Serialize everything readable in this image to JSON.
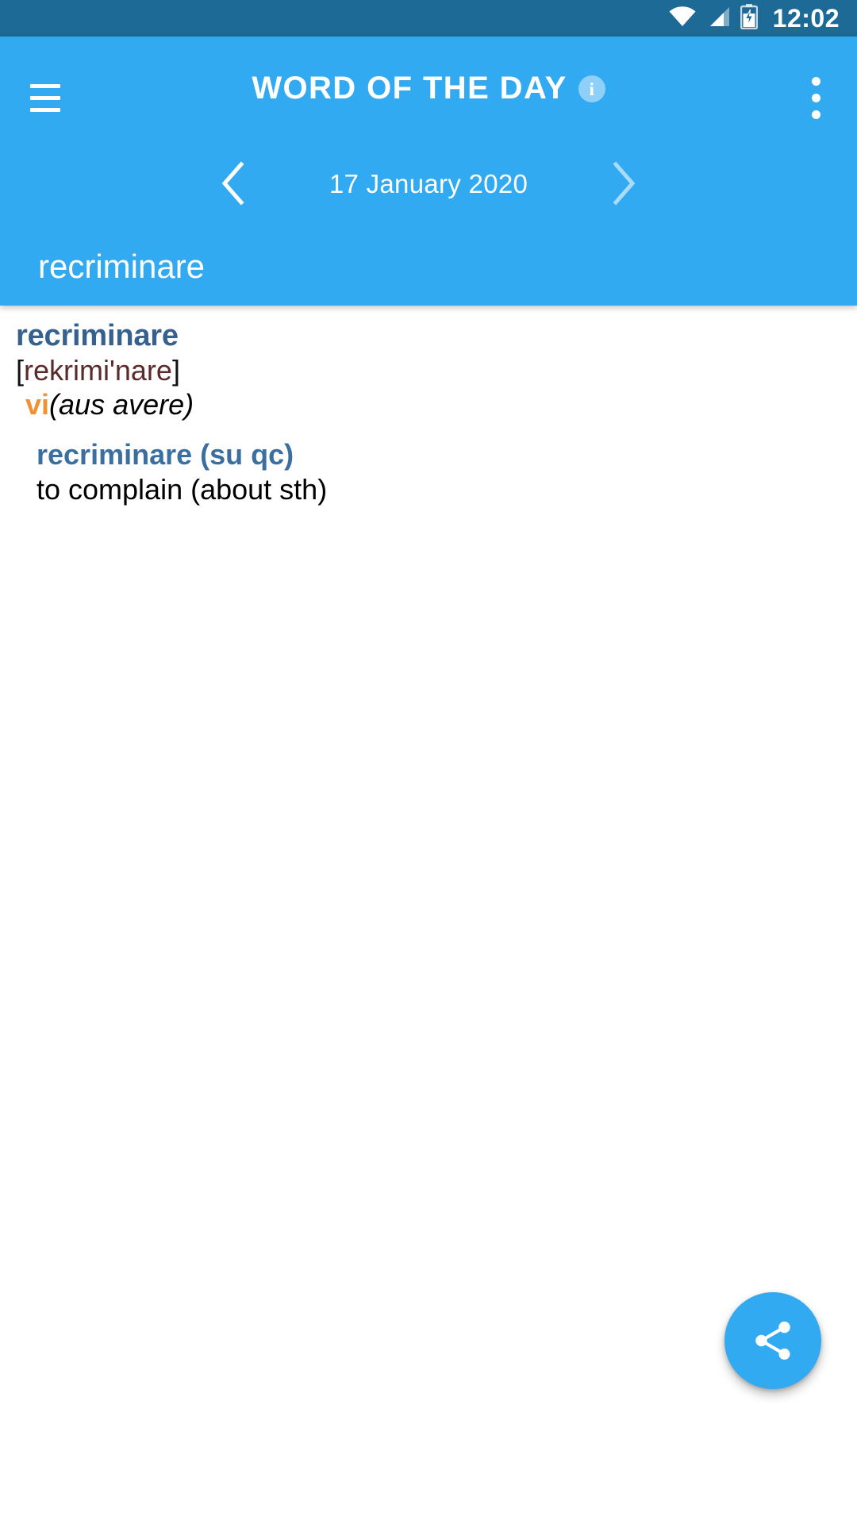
{
  "status_bar": {
    "time": "12:02",
    "wifi_icon": "wifi-icon",
    "signal_icon": "signal-bars-icon",
    "battery_icon": "battery-charging-icon",
    "background_color": "#1C6A95"
  },
  "header": {
    "background_color": "#32AAF2",
    "menu_icon": "hamburger-menu-icon",
    "title": "WORD OF THE DAY",
    "info_icon": "info-icon",
    "info_glyph": "i",
    "overflow_icon": "more-vertical-icon",
    "date_nav": {
      "prev_icon": "chevron-left-icon",
      "date": "17 January 2020",
      "next_icon": "chevron-right-icon"
    },
    "word_field": {
      "value": "recriminare",
      "placeholder": "recriminare"
    }
  },
  "entry": {
    "headword": "recriminare",
    "headword_color": "#36618E",
    "phonetic_open": "[",
    "phonetic_ipa": "rekrimi'nare",
    "phonetic_close": "]",
    "phonetic_color": "#5C2A2A",
    "part_of_speech": "vi",
    "part_of_speech_color": "#F0922F",
    "grammar_note": "(aus avere)",
    "senses": [
      {
        "source": "recriminare (su qc)",
        "source_color": "#3B6FA0",
        "target": "to complain (about sth)"
      }
    ]
  },
  "fab": {
    "icon": "share-icon",
    "background_color": "#32AAF2"
  }
}
